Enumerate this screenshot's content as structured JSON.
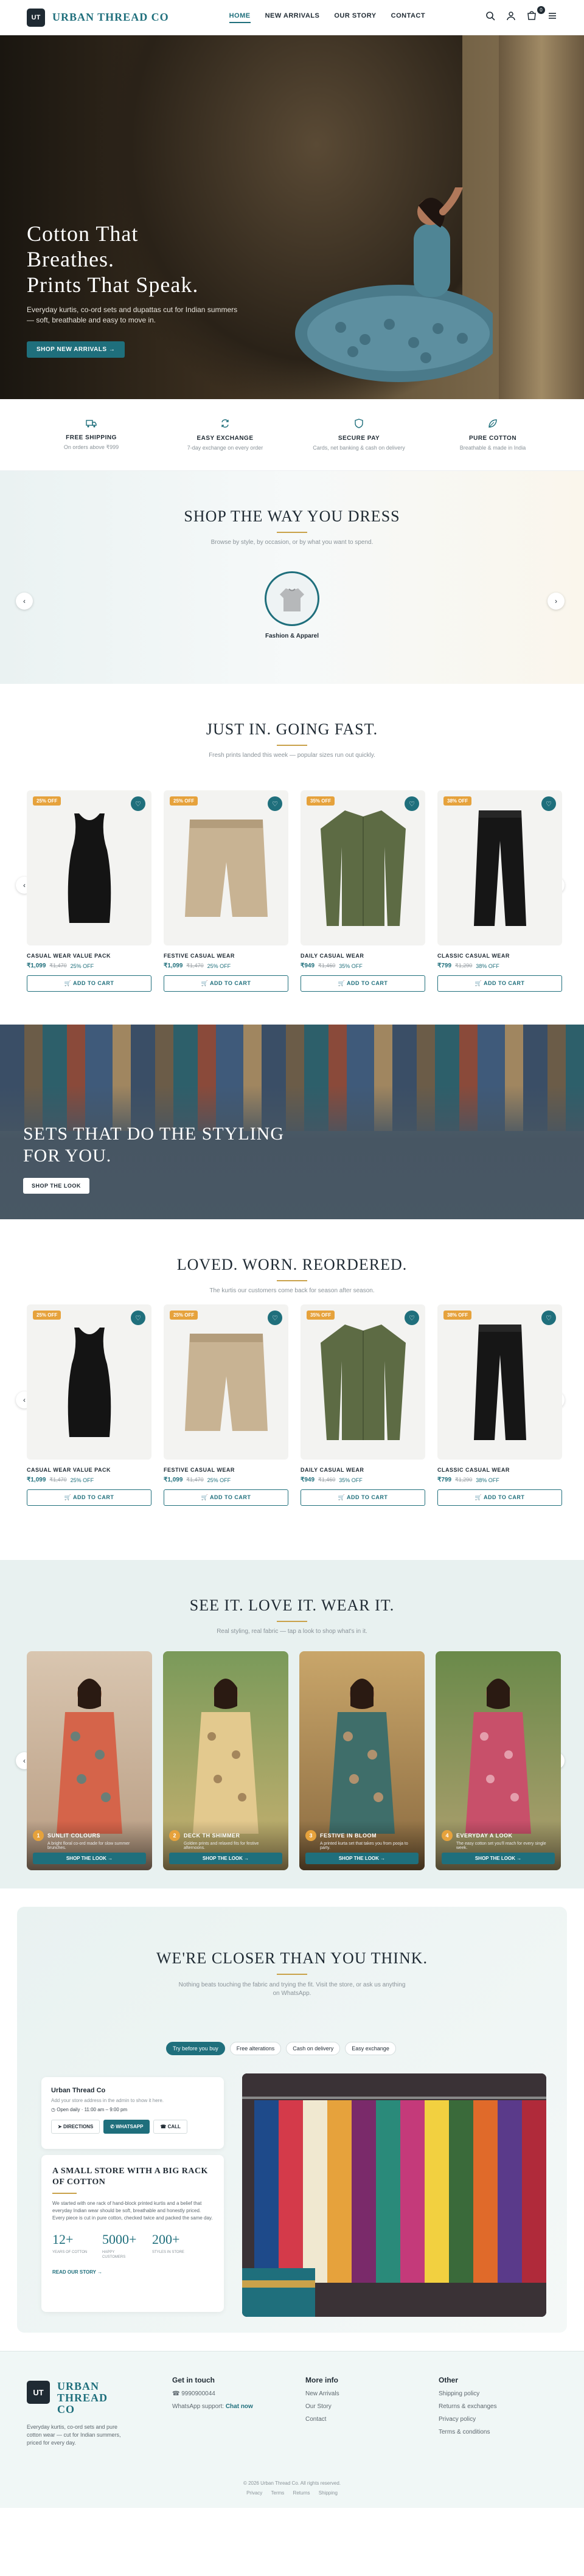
{
  "header": {
    "logo_initials": "UT",
    "brand": "URBAN THREAD CO",
    "nav": [
      "HOME",
      "NEW ARRIVALS",
      "OUR STORY",
      "CONTACT"
    ],
    "cart_count": "0"
  },
  "hero": {
    "title_line1": "Cotton That",
    "title_line2": "Breathes.",
    "title_line3": "Prints That Speak.",
    "desc": "Everyday kurtis, co-ord sets and dupattas cut for Indian summers — soft, breathable and easy to move in.",
    "cta": "SHOP NEW ARRIVALS →"
  },
  "features": [
    {
      "icon": "truck-icon",
      "title": "FREE SHIPPING",
      "sub": "On orders above ₹999"
    },
    {
      "icon": "exchange-icon",
      "title": "EASY EXCHANGE",
      "sub": "7-day exchange on every order"
    },
    {
      "icon": "shield-icon",
      "title": "SECURE PAY",
      "sub": "Cards, net banking & cash on delivery"
    },
    {
      "icon": "leaf-icon",
      "title": "PURE COTTON",
      "sub": "Breathable & made in India"
    }
  ],
  "shopway": {
    "title": "SHOP THE WAY YOU DRESS",
    "sub": "Browse by style, by occasion, or by what you want to spend.",
    "category": "Fashion & Apparel"
  },
  "just_in": {
    "title": "JUST IN. GOING FAST.",
    "sub": "Fresh prints landed this week — popular sizes run out quickly."
  },
  "products": [
    {
      "badge": "25% OFF",
      "name": "CASUAL WEAR VALUE PACK",
      "price": "₹1,099",
      "was": "₹1,470",
      "off": "25% OFF",
      "add": "ADD TO CART"
    },
    {
      "badge": "25% OFF",
      "name": "FESTIVE CASUAL WEAR",
      "price": "₹1,099",
      "was": "₹1,470",
      "off": "25% OFF",
      "add": "ADD TO CART"
    },
    {
      "badge": "35% OFF",
      "name": "DAILY CASUAL WEAR",
      "price": "₹949",
      "was": "₹1,460",
      "off": "35% OFF",
      "add": "ADD TO CART"
    },
    {
      "badge": "38% OFF",
      "name": "CLASSIC CASUAL WEAR",
      "price": "₹799",
      "was": "₹1,290",
      "off": "38% OFF",
      "add": "ADD TO CART"
    }
  ],
  "sets": {
    "title_line1": "SETS THAT DO THE STYLING",
    "title_line2": "FOR YOU.",
    "cta": "SHOP THE LOOK"
  },
  "loved": {
    "title": "LOVED. WORN. REORDERED.",
    "sub": "The kurtis our customers come back for season after season."
  },
  "seeit": {
    "title": "SEE IT. LOVE IT. WEAR IT.",
    "sub": "Real styling, real fabric — tap a look to shop what's in it.",
    "looks": [
      {
        "num": "1",
        "title": "SUNLIT COLOURS",
        "desc": "A bright floral co-ord made for slow summer brunches.",
        "cta": "SHOP THE LOOK →"
      },
      {
        "num": "2",
        "title": "DECK TH SHIMMER",
        "desc": "Golden prints and relaxed fits for festive afternoons.",
        "cta": "SHOP THE LOOK →"
      },
      {
        "num": "3",
        "title": "FESTIVE IN BLOOM",
        "desc": "A printed kurta set that takes you from pooja to party.",
        "cta": "SHOP THE LOOK →"
      },
      {
        "num": "4",
        "title": "EVERYDAY A LOOK",
        "desc": "The easy cotton set you'll reach for every single week.",
        "cta": "SHOP THE LOOK →"
      }
    ]
  },
  "closer": {
    "title": "WE'RE CLOSER THAN YOU THINK.",
    "sub": "Nothing beats touching the fabric and trying the fit. Visit the store, or ask us anything on WhatsApp.",
    "pills": [
      "Try before you buy",
      "Free alterations",
      "Cash on delivery",
      "Easy exchange"
    ],
    "store_name": "Urban Thread Co",
    "store_addr": "Add your store address in the admin to show it here.",
    "store_hours": "Open daily · 11:00 am – 9:00 pm",
    "btn_directions": "DIRECTIONS",
    "btn_whatsapp": "WHATSAPP",
    "btn_call": "CALL",
    "about_title": "A SMALL STORE WITH A BIG RACK OF COTTON",
    "about_text": "We started with one rack of hand-block printed kurtis and a belief that everyday Indian wear should be soft, breathable and honestly priced. Every piece is cut in pure cotton, checked twice and packed the same day.",
    "stats": [
      {
        "v": "12+",
        "l": "YEARS OF COTTON"
      },
      {
        "v": "5000+",
        "l": "HAPPY CUSTOMERS"
      },
      {
        "v": "200+",
        "l": "STYLES IN STORE"
      }
    ],
    "read_more": "READ OUR STORY →"
  },
  "footer": {
    "logo_initials": "UT",
    "brand_l1": "URBAN",
    "brand_l2": "THREAD",
    "brand_l3": "CO",
    "desc": "Everyday kurtis, co-ord sets and pure cotton wear — cut for Indian summers, priced for every day.",
    "touch_title": "Get in touch",
    "phone": "9990900044",
    "whatsapp_label": "WhatsApp support:",
    "whatsapp_link": "Chat now",
    "more_title": "More info",
    "more": [
      "New Arrivals",
      "Our Story",
      "Contact"
    ],
    "other_title": "Other",
    "other": [
      "Shipping policy",
      "Returns & exchanges",
      "Privacy policy",
      "Terms & conditions"
    ],
    "copy": "© 2026 Urban Thread Co. All rights reserved.",
    "links": [
      "Privacy",
      "Terms",
      "Returns",
      "Shipping"
    ]
  },
  "colors": {
    "accent": "#1f6f7c",
    "gold": "#c9a24a",
    "badge": "#e6a23c",
    "ink": "#1f2a33"
  }
}
